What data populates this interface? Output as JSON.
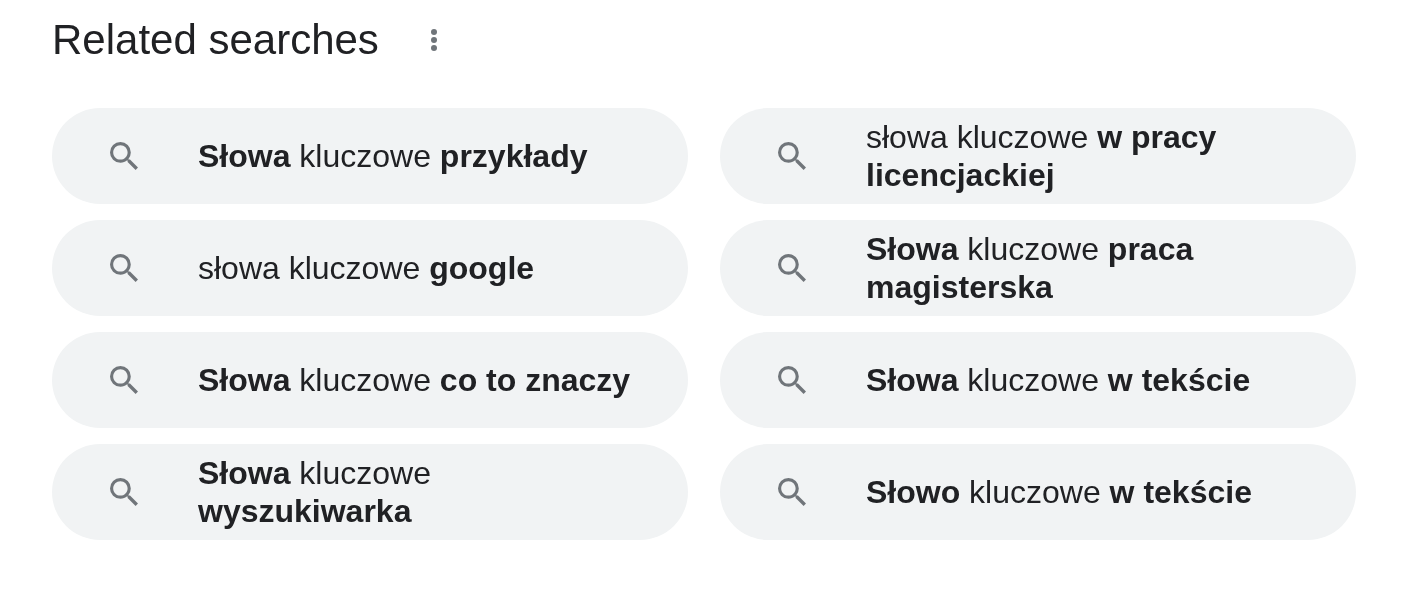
{
  "heading": {
    "title": "Related searches"
  },
  "searches": [
    {
      "text": "**Słowa** kluczowe **przykłady**"
    },
    {
      "text": "słowa kluczowe **google**"
    },
    {
      "text": "**Słowa** kluczowe **co to znaczy**"
    },
    {
      "text": "**Słowa** kluczowe **wyszukiwarka**"
    },
    {
      "text": "słowa kluczowe **w pracy licencjackiej**"
    },
    {
      "text": "**Słowa** kluczowe **praca magisterska**"
    },
    {
      "text": "**Słowa** kluczowe **w tekście**"
    },
    {
      "text": "**Słowo** kluczowe **w tekście**"
    }
  ]
}
